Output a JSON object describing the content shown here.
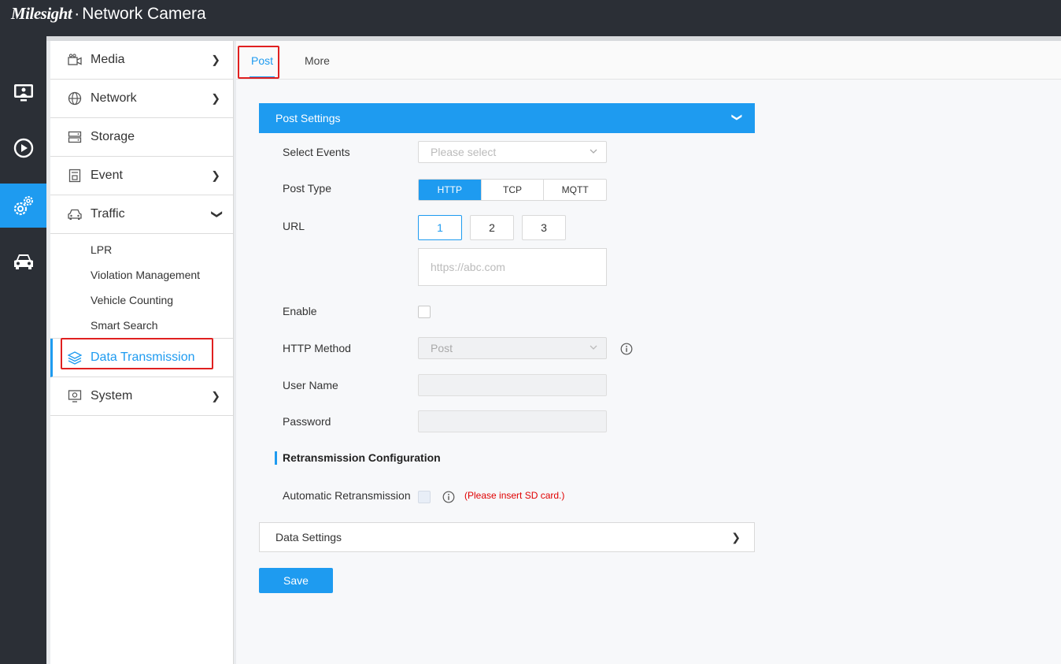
{
  "header": {
    "brand": "Milesight",
    "separator": "·",
    "product": "Network Camera"
  },
  "rail": [
    "live-view-icon",
    "playback-icon",
    "settings-icon",
    "vehicle-icon"
  ],
  "sidebar": {
    "items": [
      {
        "label": "Media"
      },
      {
        "label": "Network"
      },
      {
        "label": "Storage"
      },
      {
        "label": "Event"
      },
      {
        "label": "Traffic"
      },
      {
        "label": "Data Transmission"
      },
      {
        "label": "System"
      }
    ],
    "traffic_sub": [
      "LPR",
      "Violation Management",
      "Vehicle Counting",
      "Smart Search"
    ]
  },
  "tabs": {
    "post": "Post",
    "more": "More"
  },
  "post_settings": {
    "title": "Post Settings",
    "select_events_label": "Select Events",
    "select_events_placeholder": "Please select",
    "post_type_label": "Post Type",
    "post_types": [
      "HTTP",
      "TCP",
      "MQTT"
    ],
    "post_type_selected": "HTTP",
    "url_label": "URL",
    "url_buttons": [
      "1",
      "2",
      "3"
    ],
    "url_placeholder": "https://abc.com",
    "enable_label": "Enable",
    "http_method_label": "HTTP Method",
    "http_method_value": "Post",
    "user_name_label": "User Name",
    "password_label": "Password"
  },
  "retransmission": {
    "title": "Retransmission Configuration",
    "auto_label": "Automatic Retransmission",
    "warning": "(Please insert SD card.)"
  },
  "data_settings": {
    "title": "Data Settings"
  },
  "save_label": "Save",
  "colors": {
    "accent": "#1e9bf0",
    "topbar": "#2b2f36",
    "warning": "#e00000",
    "highlight_box": "#e02020"
  }
}
